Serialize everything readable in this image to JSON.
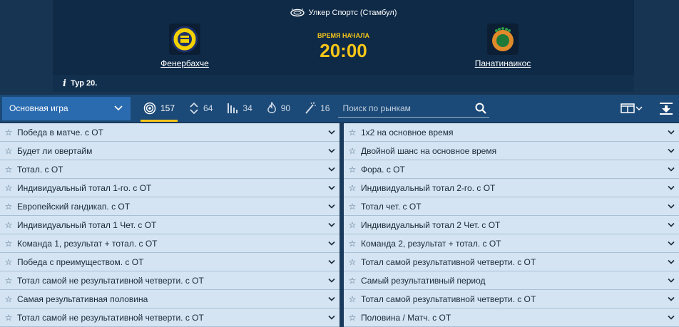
{
  "match": {
    "venue": "Улкер Спортс (Стамбул)",
    "home_team": "Фенербахче",
    "away_team": "Панатинаикос",
    "start_label": "ВРЕМЯ НАЧАЛА",
    "start_time": "20:00",
    "round": "Тур 20."
  },
  "toolbar": {
    "select_value": "Основная игра",
    "filters": [
      {
        "icon": "target-icon",
        "count": "157"
      },
      {
        "icon": "up-down-arrows-icon",
        "count": "64"
      },
      {
        "icon": "bars-icon",
        "count": "34"
      },
      {
        "icon": "flame-icon",
        "count": "90"
      },
      {
        "icon": "magic-wand-icon",
        "count": "16"
      }
    ],
    "search_placeholder": "Поиск по рынкам"
  },
  "markets": {
    "left": [
      "Победа в матче. с ОТ",
      "Будет ли овертайм",
      "Тотал. с ОТ",
      "Индивидуальный тотал 1-го. с ОТ",
      "Европейский гандикап. с ОТ",
      "Индивидуальный тотал 1 Чет. с ОТ",
      "Команда 1, результат + тотал. с ОТ",
      "Победа с преимуществом. с ОТ",
      "Тотал самой не результативной четверти. с ОТ",
      "Самая результативная половина",
      "Тотал самой не результативной четверти. с ОТ"
    ],
    "right": [
      "1х2 на основное время",
      "Двойной шанс на основное время",
      "Фора. с ОТ",
      "Индивидуальный тотал 2-го. с ОТ",
      "Тотал чет. с ОТ",
      "Индивидуальный тотал 2 Чет. с ОТ",
      "Команда 2, результат + тотал. с ОТ",
      "Тотал самой результативной четверти. с ОТ",
      "Самый результативный период",
      "Тотал самой результативной четверти. с ОТ",
      "Половина / Матч. с ОТ"
    ]
  },
  "colors": {
    "accent": "#f5c518",
    "toolbar": "#1c4a78",
    "select": "#2a6bb0",
    "row": "#d4e4f2"
  }
}
